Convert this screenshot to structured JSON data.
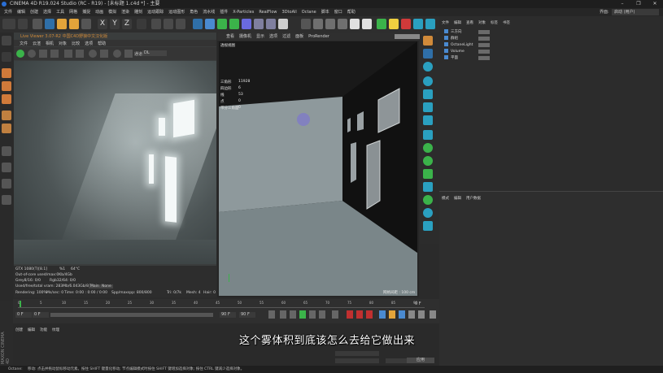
{
  "window": {
    "title": "CINEMA 4D R19.024 Studio (RC - R19) - [未标题 1.c4d *] - 主要",
    "interface_label": "界面:",
    "interface_value": "启动 (用户)"
  },
  "menu": [
    "文件",
    "编辑",
    "创建",
    "选择",
    "工具",
    "网格",
    "捕捉",
    "动画",
    "模拟",
    "渲染",
    "雕刻",
    "运动跟踪",
    "运动图形",
    "角色",
    "流水线",
    "插件",
    "X-Particles",
    "RealFlow",
    "3DtoAll",
    "Octane",
    "脚本",
    "窗口",
    "帮助"
  ],
  "toolbar_axes": [
    "X",
    "Y",
    "Z"
  ],
  "liveviewer": {
    "title": "Live Viewer 3.07-R2 中国C4D野狼中文汉化版",
    "menu": [
      "文件",
      "云渲",
      "相机",
      "对象",
      "比较",
      "选项",
      "帮助"
    ],
    "channel_label": "通道",
    "channel_value": "DL",
    "stats": {
      "gpu": "GTX 1080(T)[8.1]",
      "gpu_pct": "%1",
      "gpu_temp": "64°C",
      "outofcore": "Out-of-core used/max:0Kb/4Gb",
      "grey": "Grey8/16: 0/0",
      "rgb": "Rgb32/64: 0/0",
      "vram": "Used/free/total vram: 283Mb/6.043Gb/8Gb",
      "main": "Main",
      "none": "None",
      "rendering": "Rendering: 100%",
      "meshes": "Ms/sec: 0",
      "time": "Time: 0:00 : 0:00 / 0:00",
      "spp": "Spp/maxspp: 800/800",
      "tri": "Tri: 0/7k",
      "mesh": "Mesh: 4",
      "hair": "Hair: 0"
    }
  },
  "viewport": {
    "menu": [
      "查看",
      "摄像机",
      "显示",
      "选项",
      "过滤",
      "面板",
      "ProRender"
    ],
    "label": "透视视图",
    "hud": [
      {
        "k": "三角形",
        "v": "11928"
      },
      {
        "k": "四边形",
        "v": "6"
      },
      {
        "k": "线",
        "v": "53"
      },
      {
        "k": "点",
        "v": "0"
      },
      {
        "k": "带分三角面",
        "v": "0"
      }
    ],
    "grid_size": "网格间距 : 100 cm"
  },
  "objects": {
    "tabs": [
      "文件",
      "编辑",
      "查看",
      "对象",
      "标签",
      "书签"
    ],
    "items": [
      "三方向",
      "群组",
      "OctaneLight",
      "Volume",
      "平面"
    ]
  },
  "attributes": {
    "tabs": [
      "模式",
      "编辑",
      "用户数据"
    ]
  },
  "timeline": {
    "ticks": [
      "0",
      "5",
      "10",
      "15",
      "20",
      "25",
      "30",
      "35",
      "40",
      "45",
      "50",
      "55",
      "60",
      "65",
      "70",
      "75",
      "80",
      "85",
      "90"
    ],
    "start": "0 F",
    "current": "0 F",
    "end": "90 F",
    "end2": "90 F",
    "frame": "0 F"
  },
  "materials": {
    "tabs": [
      "创建",
      "编辑",
      "功能",
      "纹理"
    ],
    "apply": "应用"
  },
  "status": {
    "app": "Octane:",
    "text": "移动: 点击并拖动鼠标移动元素。按住 SHIFT 键量化移动; 节点编辑模式时按住 SHIFT 键增加选择对象; 按住 CTRL 键减少选择对象。"
  },
  "subtitle": "这个雾体积到底该怎么去给它做出来",
  "colors": {
    "accent": "#d08a3a",
    "toolbar_blue": "#2f6fa8",
    "toolbar_orange": "#e3a43a",
    "green": "#3bb34a",
    "cyan": "#2aa0c0"
  }
}
